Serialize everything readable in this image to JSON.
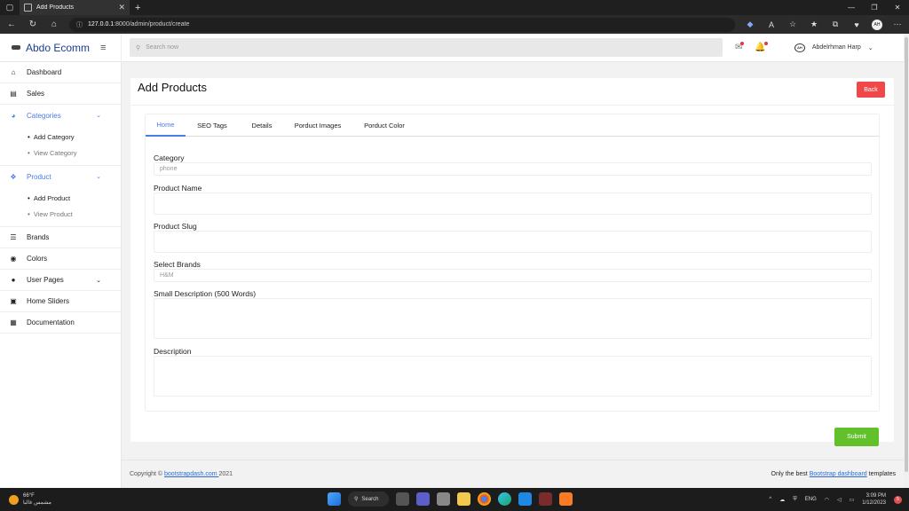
{
  "browser": {
    "tab_title": "Add Products",
    "url_host": "127.0.0.1",
    "url_path": ":8000/admin/product/create"
  },
  "header": {
    "brand": "Abdo Ecomm",
    "search_placeholder": "Search now",
    "user_name": "Abdelrhman Harp",
    "avatar_text": "AH"
  },
  "sidebar": {
    "items": [
      {
        "label": "Dashboard",
        "icon": "home-icon"
      },
      {
        "label": "Sales",
        "icon": "receipt-icon"
      },
      {
        "label": "Categories",
        "icon": "pie-chart-icon"
      },
      {
        "label": "Product",
        "icon": "dropbox-icon"
      },
      {
        "label": "Brands",
        "icon": "list-icon"
      },
      {
        "label": "Colors",
        "icon": "palette-icon"
      },
      {
        "label": "User Pages",
        "icon": "user-icon"
      },
      {
        "label": "Home Sliders",
        "icon": "slides-icon"
      },
      {
        "label": "Documentation",
        "icon": "document-icon"
      }
    ],
    "categories_sub": [
      "Add Category",
      "View Category"
    ],
    "product_sub": [
      "Add Product",
      "View Product"
    ]
  },
  "main": {
    "title": "Add Products",
    "back_label": "Back",
    "tabs": [
      "Home",
      "SEO Tags",
      "Details",
      "Porduct Images",
      "Porduct Color"
    ],
    "fields": {
      "category_label": "Category",
      "category_value": "phone",
      "name_label": "Product Name",
      "slug_label": "Product Slug",
      "brands_label": "Select Brands",
      "brands_value": "H&M",
      "small_desc_label": "Small Description (500 Words)",
      "desc_label": "Description"
    },
    "submit_label": "Submit"
  },
  "footer": {
    "copyright_prefix": "Copyright © ",
    "copyright_link": "bootstrapdash.com ",
    "copyright_year": "2021",
    "right_prefix": "Only the best ",
    "right_link": "Bootstrap dashboard",
    "right_suffix": " templates"
  },
  "taskbar": {
    "temp": "66°F",
    "weather_desc": "مشمس غالبا",
    "search_label": "Search",
    "lang": "ENG",
    "time": "3:09 PM",
    "date": "1/12/2023",
    "notif_count": "5"
  },
  "colors": {
    "accent": "#4b7be5",
    "back_button": "#f04848",
    "submit_button": "#62c12a",
    "brand_text": "#1a3d8f"
  }
}
